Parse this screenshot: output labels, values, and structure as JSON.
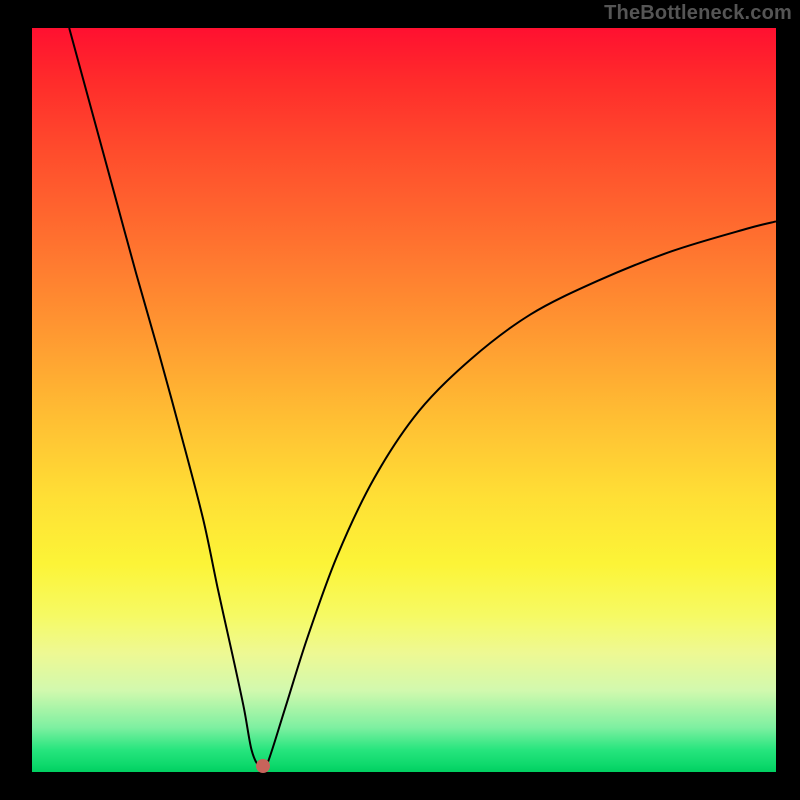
{
  "watermark": "TheBottleneck.com",
  "chart_data": {
    "type": "line",
    "title": "",
    "xlabel": "",
    "ylabel": "",
    "xlim": [
      0,
      100
    ],
    "ylim": [
      0,
      100
    ],
    "background_gradient": {
      "top": "#ff1030",
      "bottom": "#00cf61",
      "note": "red-orange-yellow-green vertical gradient; green near bottom, red at top"
    },
    "series": [
      {
        "name": "bottleneck-curve",
        "color": "#000000",
        "x": [
          5,
          8,
          11,
          14,
          17,
          20,
          23,
          25,
          27,
          28.5,
          29.5,
          30.5,
          31.5,
          34,
          37,
          41,
          46,
          52,
          59,
          67,
          76,
          86,
          96,
          100
        ],
        "y": [
          100,
          89,
          78,
          67,
          56.5,
          45.5,
          34,
          24.5,
          15.5,
          8.5,
          3,
          0.8,
          0.8,
          8.5,
          18,
          29,
          39.5,
          48.5,
          55.5,
          61.5,
          66,
          70,
          73,
          74
        ]
      }
    ],
    "marker": {
      "name": "min-point",
      "x": 31,
      "y": 0.8,
      "color": "#c8645b"
    },
    "grid": false,
    "legend": false
  }
}
